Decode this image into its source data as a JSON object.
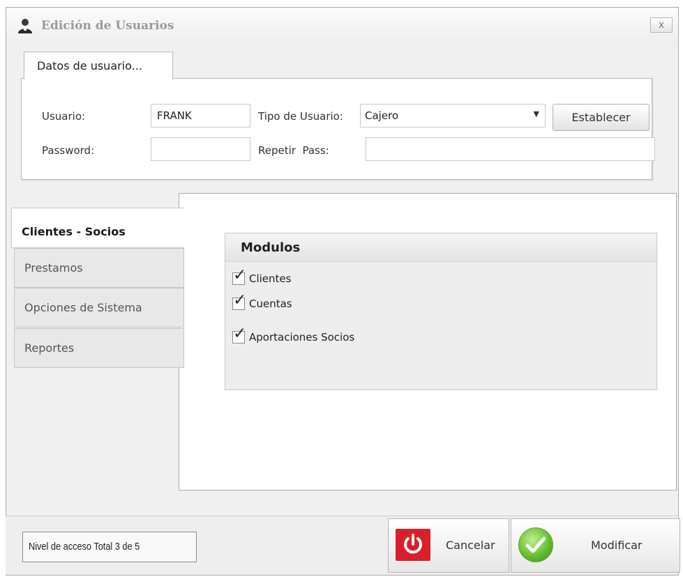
{
  "window": {
    "title": "Edición de Usuarios",
    "close_label": "x"
  },
  "user_group": {
    "tab_label": "Datos de usuario...",
    "usuario_label": "Usuario:",
    "usuario_value": "FRANK",
    "password_label": "Password:",
    "password_value": "",
    "tipo_label": "Tipo de Usuario:",
    "tipo_value": "Cajero",
    "repetir_label": "Repetir  Pass:",
    "repetir_value": "",
    "establecer_label": "Establecer"
  },
  "nav_tabs": [
    {
      "label": "Clientes - Socios",
      "active": true
    },
    {
      "label": "Prestamos",
      "active": false
    },
    {
      "label": "Opciones de Sistema",
      "active": false
    },
    {
      "label": "Reportes",
      "active": false
    }
  ],
  "modulos": {
    "title": "Modulos",
    "items": [
      {
        "label": "Clientes",
        "checked": true
      },
      {
        "label": "Cuentas",
        "checked": true
      },
      {
        "label": "Aportaciones Socios",
        "checked": true
      }
    ]
  },
  "footer": {
    "access_level": "Nivel de acceso Total 3 de 5",
    "cancel_label": "Cancelar",
    "modify_label": "Modificar"
  },
  "colors": {
    "cancel_icon": "#d9202a",
    "modify_icon": "#5fba2a",
    "checkbox_accent": "#2e5fa8"
  },
  "icons": {
    "app": "user-icon",
    "cancel": "power-icon",
    "modify": "checkmark-circle-icon"
  }
}
